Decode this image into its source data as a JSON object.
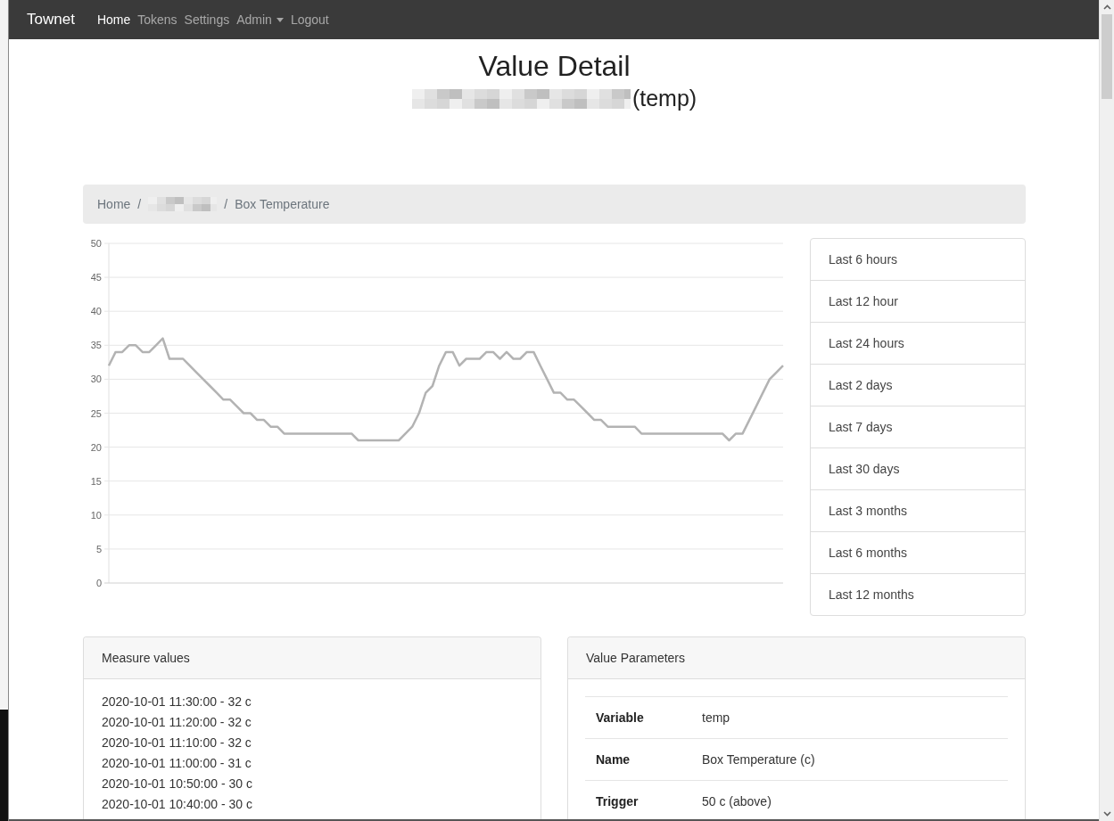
{
  "navbar": {
    "brand": "Townet",
    "items": [
      {
        "label": "Home",
        "selected": true,
        "kind": "link"
      },
      {
        "label": "Tokens",
        "selected": false,
        "kind": "link"
      },
      {
        "label": "Settings",
        "selected": false,
        "kind": "link"
      },
      {
        "label": "Admin",
        "selected": false,
        "kind": "dropdown"
      },
      {
        "label": "Logout",
        "selected": false,
        "kind": "link"
      }
    ]
  },
  "header": {
    "title": "Value Detail",
    "subtitle": "(temp)"
  },
  "breadcrumb": [
    {
      "kind": "link",
      "label": "Home"
    },
    {
      "kind": "separator",
      "label": "/"
    },
    {
      "kind": "redacted"
    },
    {
      "kind": "separator",
      "label": "/"
    },
    {
      "kind": "current",
      "label": "Box Temperature"
    }
  ],
  "chart": {
    "chart_data": {
      "type": "line",
      "grid": true,
      "ylim": [
        0,
        50
      ],
      "yticks": [
        0,
        5,
        10,
        15,
        20,
        25,
        30,
        35,
        40,
        45,
        50
      ],
      "series": [
        {
          "color": "#b3b3b3",
          "values": [
            32,
            34,
            34,
            35,
            35,
            34,
            34,
            35,
            36,
            33,
            33,
            33,
            32,
            31,
            30,
            29,
            28,
            27,
            27,
            26,
            25,
            25,
            24,
            24,
            23,
            23,
            22,
            22,
            22,
            22,
            22,
            22,
            22,
            22,
            22,
            22,
            22,
            21,
            21,
            21,
            21,
            21,
            21,
            21,
            22,
            23,
            25,
            28,
            29,
            32,
            34,
            34,
            32,
            33,
            33,
            33,
            34,
            34,
            33,
            34,
            33,
            33,
            34,
            34,
            32,
            30,
            28,
            28,
            27,
            27,
            26,
            25,
            24,
            24,
            23,
            23,
            23,
            23,
            23,
            22,
            22,
            22,
            22,
            22,
            22,
            22,
            22,
            22,
            22,
            22,
            22,
            22,
            21,
            22,
            22,
            24,
            26,
            28,
            30,
            31,
            32
          ]
        }
      ]
    }
  },
  "ranges": [
    "Last 6 hours",
    "Last 12 hour",
    "Last 24 hours",
    "Last 2 days",
    "Last 7 days",
    "Last 30 days",
    "Last 3 months",
    "Last 6 months",
    "Last 12 months"
  ],
  "measure_values": {
    "title": "Measure values",
    "items": [
      "2020-10-01 11:30:00 - 32 c",
      "2020-10-01 11:20:00 - 32 c",
      "2020-10-01 11:10:00 - 32 c",
      "2020-10-01 11:00:00 - 31 c",
      "2020-10-01 10:50:00 - 30 c",
      "2020-10-01 10:40:00 - 30 c"
    ]
  },
  "parameters": {
    "title": "Value Parameters",
    "rows": [
      {
        "label": "Variable",
        "value": "temp"
      },
      {
        "label": "Name",
        "value": "Box Temperature (c)"
      },
      {
        "label": "Trigger",
        "value": "50 c (above)"
      }
    ]
  }
}
